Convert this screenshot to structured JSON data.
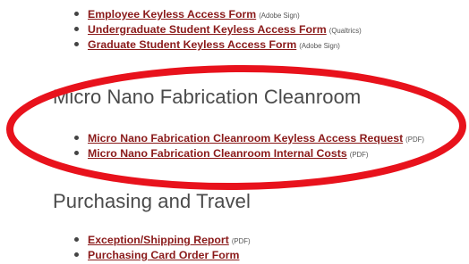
{
  "top_list": [
    {
      "label": "Employee Keyless Access Form",
      "note": "(Adobe Sign)"
    },
    {
      "label": "Undergraduate Student Keyless Access Form",
      "note": "(Qualtrics)"
    },
    {
      "label": "Graduate Student Keyless Access Form",
      "note": "(Adobe Sign)"
    }
  ],
  "cleanroom": {
    "heading": "Micro Nano Fabrication Cleanroom",
    "items": [
      {
        "label": "Micro Nano Fabrication Cleanroom Keyless Access Request",
        "note": "(PDF)"
      },
      {
        "label": "Micro Nano Fabrication Cleanroom Internal Costs",
        "note": "(PDF)"
      }
    ]
  },
  "purchasing": {
    "heading": "Purchasing and Travel",
    "items": [
      {
        "label": "Exception/Shipping Report",
        "note": "(PDF)"
      },
      {
        "label": "Purchasing Card Order Form",
        "note": ""
      }
    ]
  },
  "colors": {
    "link": "#8a1a1a",
    "highlight": "#e8121c",
    "heading": "#4a4a4a"
  }
}
